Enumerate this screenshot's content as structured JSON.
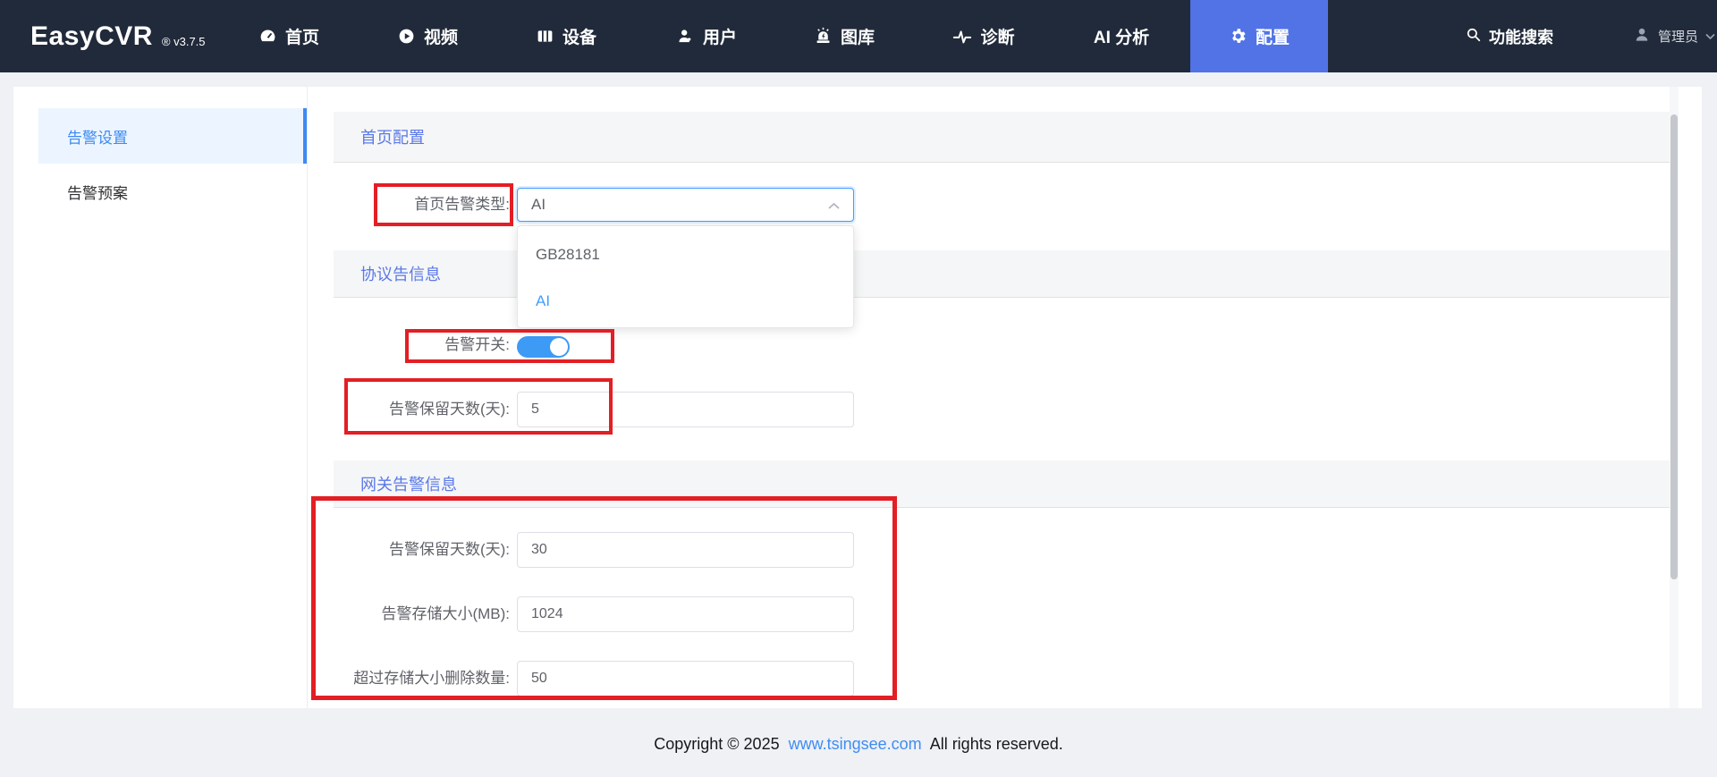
{
  "app": {
    "name": "EasyCVR",
    "version": "® v3.7.5"
  },
  "nav": {
    "items": [
      {
        "label": "首页",
        "icon": "dashboard-icon",
        "active": false
      },
      {
        "label": "视频",
        "icon": "video-icon",
        "active": false
      },
      {
        "label": "设备",
        "icon": "device-icon",
        "active": false
      },
      {
        "label": "用户",
        "icon": "user-icon",
        "active": false
      },
      {
        "label": "图库",
        "icon": "alarm-lamp-icon",
        "active": false
      },
      {
        "label": "诊断",
        "icon": "diagnosis-icon",
        "active": false
      },
      {
        "label": "AI 分析",
        "icon": "",
        "active": false
      },
      {
        "label": "配置",
        "icon": "gear-icon",
        "active": true
      }
    ],
    "search_label": "功能搜索",
    "user_label": "管理员"
  },
  "sidebar": {
    "items": [
      {
        "label": "告警设置",
        "active": true
      },
      {
        "label": "告警预案",
        "active": false
      }
    ]
  },
  "main": {
    "sections": [
      {
        "title": "首页配置"
      },
      {
        "title": "协议告信息"
      },
      {
        "title": "网关告警信息"
      }
    ],
    "home_alarm_type": {
      "label": "首页告警类型:",
      "value": "AI",
      "options": [
        {
          "label": "GB28181",
          "selected": false
        },
        {
          "label": "AI",
          "selected": true
        }
      ]
    },
    "alarm_switch": {
      "label": "告警开关:",
      "on": true
    },
    "protocol_fields": [
      {
        "label": "告警保留天数(天):",
        "value": "5"
      }
    ],
    "gateway_fields": [
      {
        "label": "告警保留天数(天):",
        "value": "30"
      },
      {
        "label": "告警存储大小(MB):",
        "value": "1024"
      },
      {
        "label": "超过存储大小删除数量:",
        "value": "50"
      }
    ]
  },
  "footer": {
    "prefix": "Copyright © 2025",
    "link": "www.tsingsee.com",
    "suffix": "All rights reserved."
  },
  "colors": {
    "nav_bg": "#212a3a",
    "active_tab_blue": "#5173e6",
    "primary_blue": "#409eff",
    "section_title_blue": "#5b79e8",
    "sidebar_active_bg": "#ecf5ff",
    "annotation_red": "#e31e24",
    "link_blue": "#3f8cf3"
  }
}
